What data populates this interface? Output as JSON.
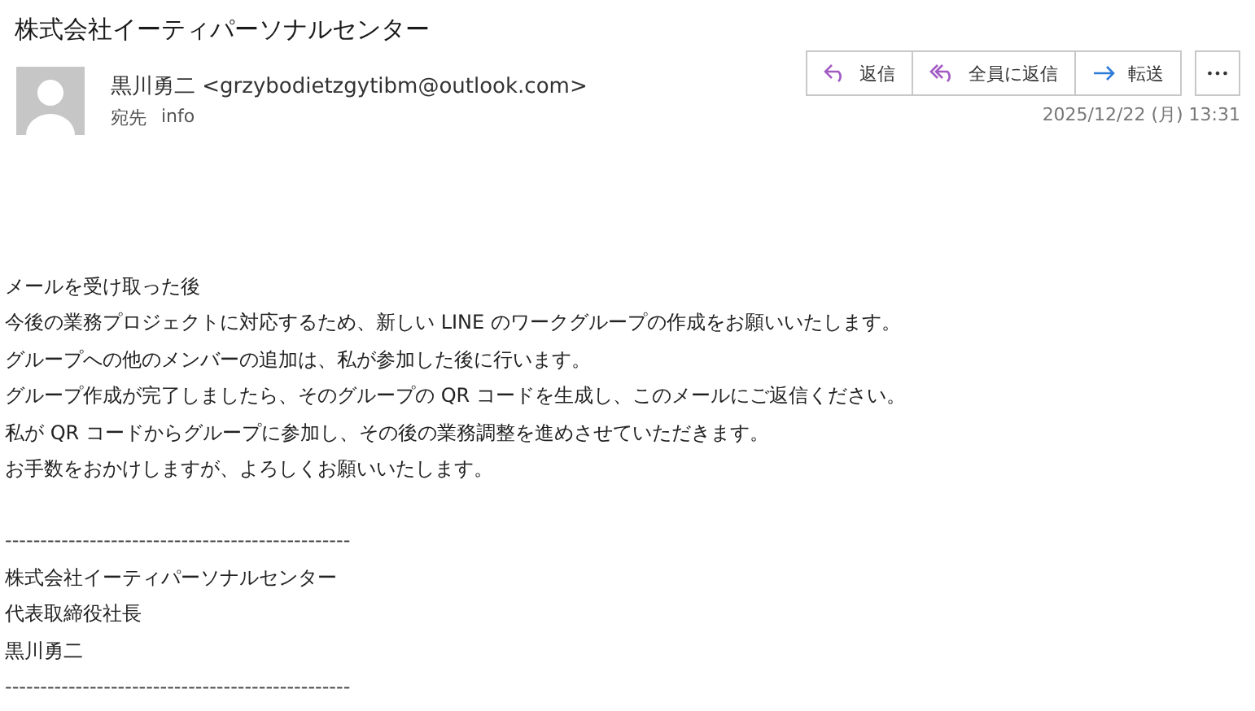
{
  "subject": "株式会社イーティパーソナルセンター",
  "sender": {
    "name": "黒川勇二",
    "email": "<grzybodietzgytibm@outlook.com>"
  },
  "recipient": {
    "label": "宛先",
    "value": "info"
  },
  "actions": [
    {
      "kind": "reply",
      "label": "返信"
    },
    {
      "kind": "reply_all",
      "label": "全員に返信"
    },
    {
      "kind": "forward",
      "label": "転送"
    },
    {
      "kind": "more",
      "label": "•••"
    }
  ],
  "date": "2025/12/22 (月) 13:31",
  "body": [
    "メールを受け取った後",
    "今後の業務プロジェクトに対応するため、新しい LINE のワークグループの作成をお願いいたします。",
    "グループへの他のメンバーの追加は、私が参加した後に行います。",
    "グループ作成が完了しましたら、そのグループの QR コードを生成し、このメールにご返信ください。",
    "私が QR コードからグループに参加し、その後の業務調整を進めさせていただきます。",
    "お手数をおかけしますが、よろしくお願いいたします。"
  ],
  "signature": [
    {
      "kind": "rule",
      "text": "-------------------------------------------------"
    },
    {
      "kind": "line",
      "text": "株式会社イーティパーソナルセンター"
    },
    {
      "kind": "line",
      "text": "代表取締役社長"
    },
    {
      "kind": "line",
      "text": "黒川勇二"
    },
    {
      "kind": "rule",
      "text": "-------------------------------------------------"
    }
  ]
}
